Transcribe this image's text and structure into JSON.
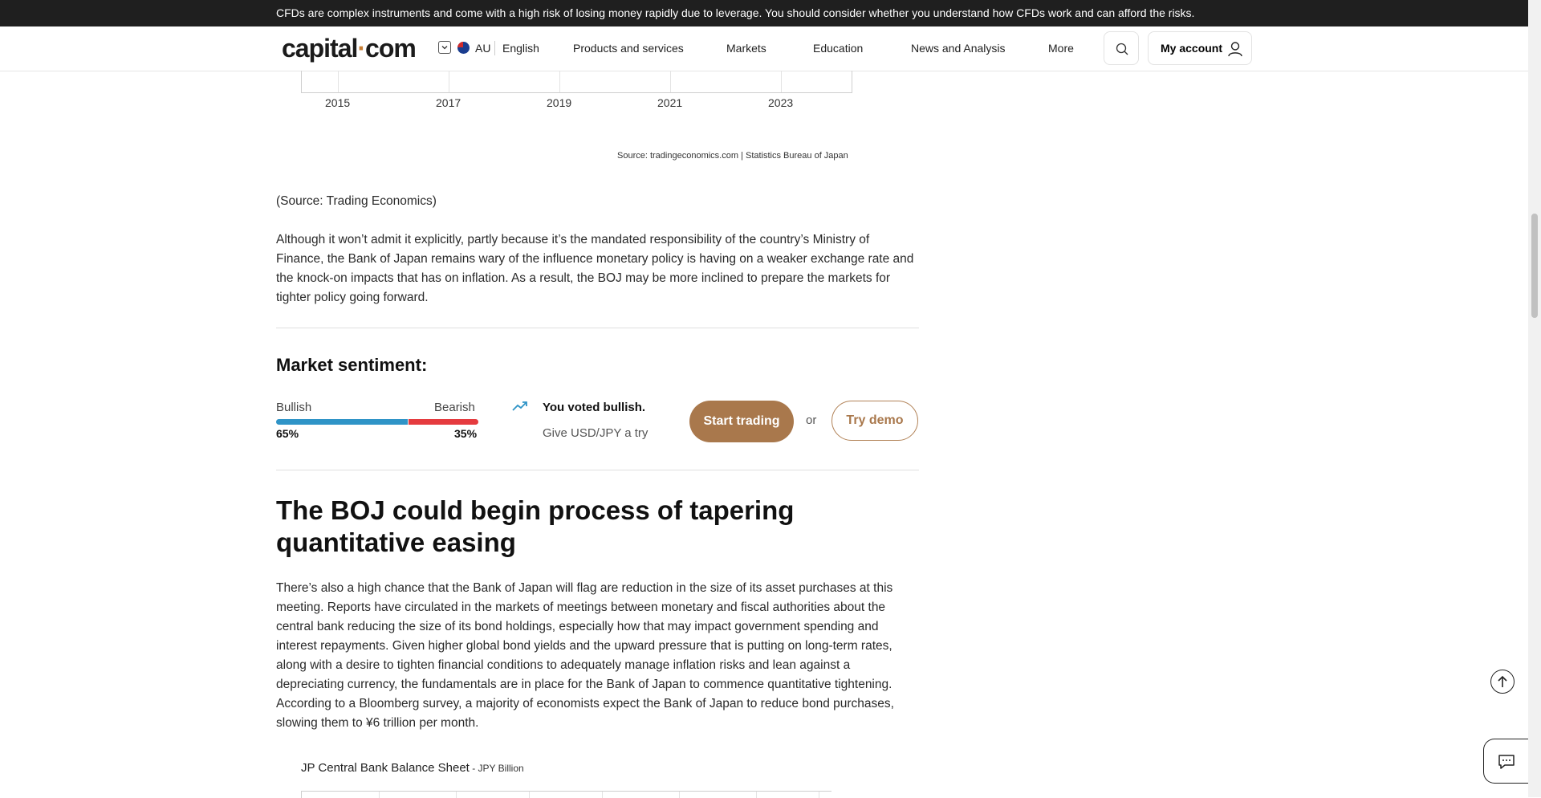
{
  "risk_warning": "CFDs are complex instruments and come with a high risk of losing money rapidly due to leverage. You should consider whether you understand how CFDs work and can afford the risks.",
  "header": {
    "logo_main": "capital",
    "logo_dot": "·",
    "logo_tail": "com",
    "region": "AU",
    "language": "English",
    "nav": [
      "Products and services",
      "Markets",
      "Education",
      "News and Analysis",
      "More"
    ],
    "account_label": "My account"
  },
  "chart_top": {
    "x_ticks": [
      "2015",
      "2017",
      "2019",
      "2021",
      "2023"
    ],
    "source": "Source: tradingeconomics.com | Statistics Bureau of Japan"
  },
  "source_note": "(Source: Trading Economics)",
  "paragraph1": "Although it won’t admit it explicitly, partly because it’s the mandated responsibility of the country’s Ministry of Finance, the Bank of Japan remains wary of the influence monetary policy is having on a weaker exchange rate and the knock-on impacts that has on inflation. As a result, the BOJ may be more inclined to prepare the markets for tighter policy going forward.",
  "sentiment": {
    "title": "Market sentiment:",
    "bullish_label": "Bullish",
    "bearish_label": "Bearish",
    "bullish_pct": "65%",
    "bearish_pct": "35%",
    "bullish_fraction": 0.65,
    "voted_text": "You voted bullish.",
    "give_text": "Give USD/JPY a try",
    "start_label": "Start trading",
    "or_text": "or",
    "demo_label": "Try demo",
    "colors": {
      "bull": "#2f94c7",
      "bear": "#e53b3f",
      "cta": "#a9784c"
    }
  },
  "heading2": "The BOJ could begin process of tapering quantitative easing",
  "paragraph2": "There’s also a high chance that the Bank of Japan will flag are reduction in the size of its asset purchases at this meeting. Reports have circulated in the markets of meetings between monetary and fiscal authorities about the central bank reducing the size of its bond holdings, especially how that may impact government spending and interest repayments. Given higher global bond yields and the upward pressure that is putting on long-term rates, along with a desire to tighten financial conditions to adequately manage inflation risks and lean against a depreciating currency, the fundamentals are in place for the Bank of Japan to commence quantitative tightening. According to a Bloomberg survey, a majority of economists expect the Bank of Japan to reduce bond purchases, slowing them to ¥6 trillion per month.",
  "chart2": {
    "title": "JP Central Bank Balance Sheet",
    "subtitle": " - JPY Billion"
  }
}
